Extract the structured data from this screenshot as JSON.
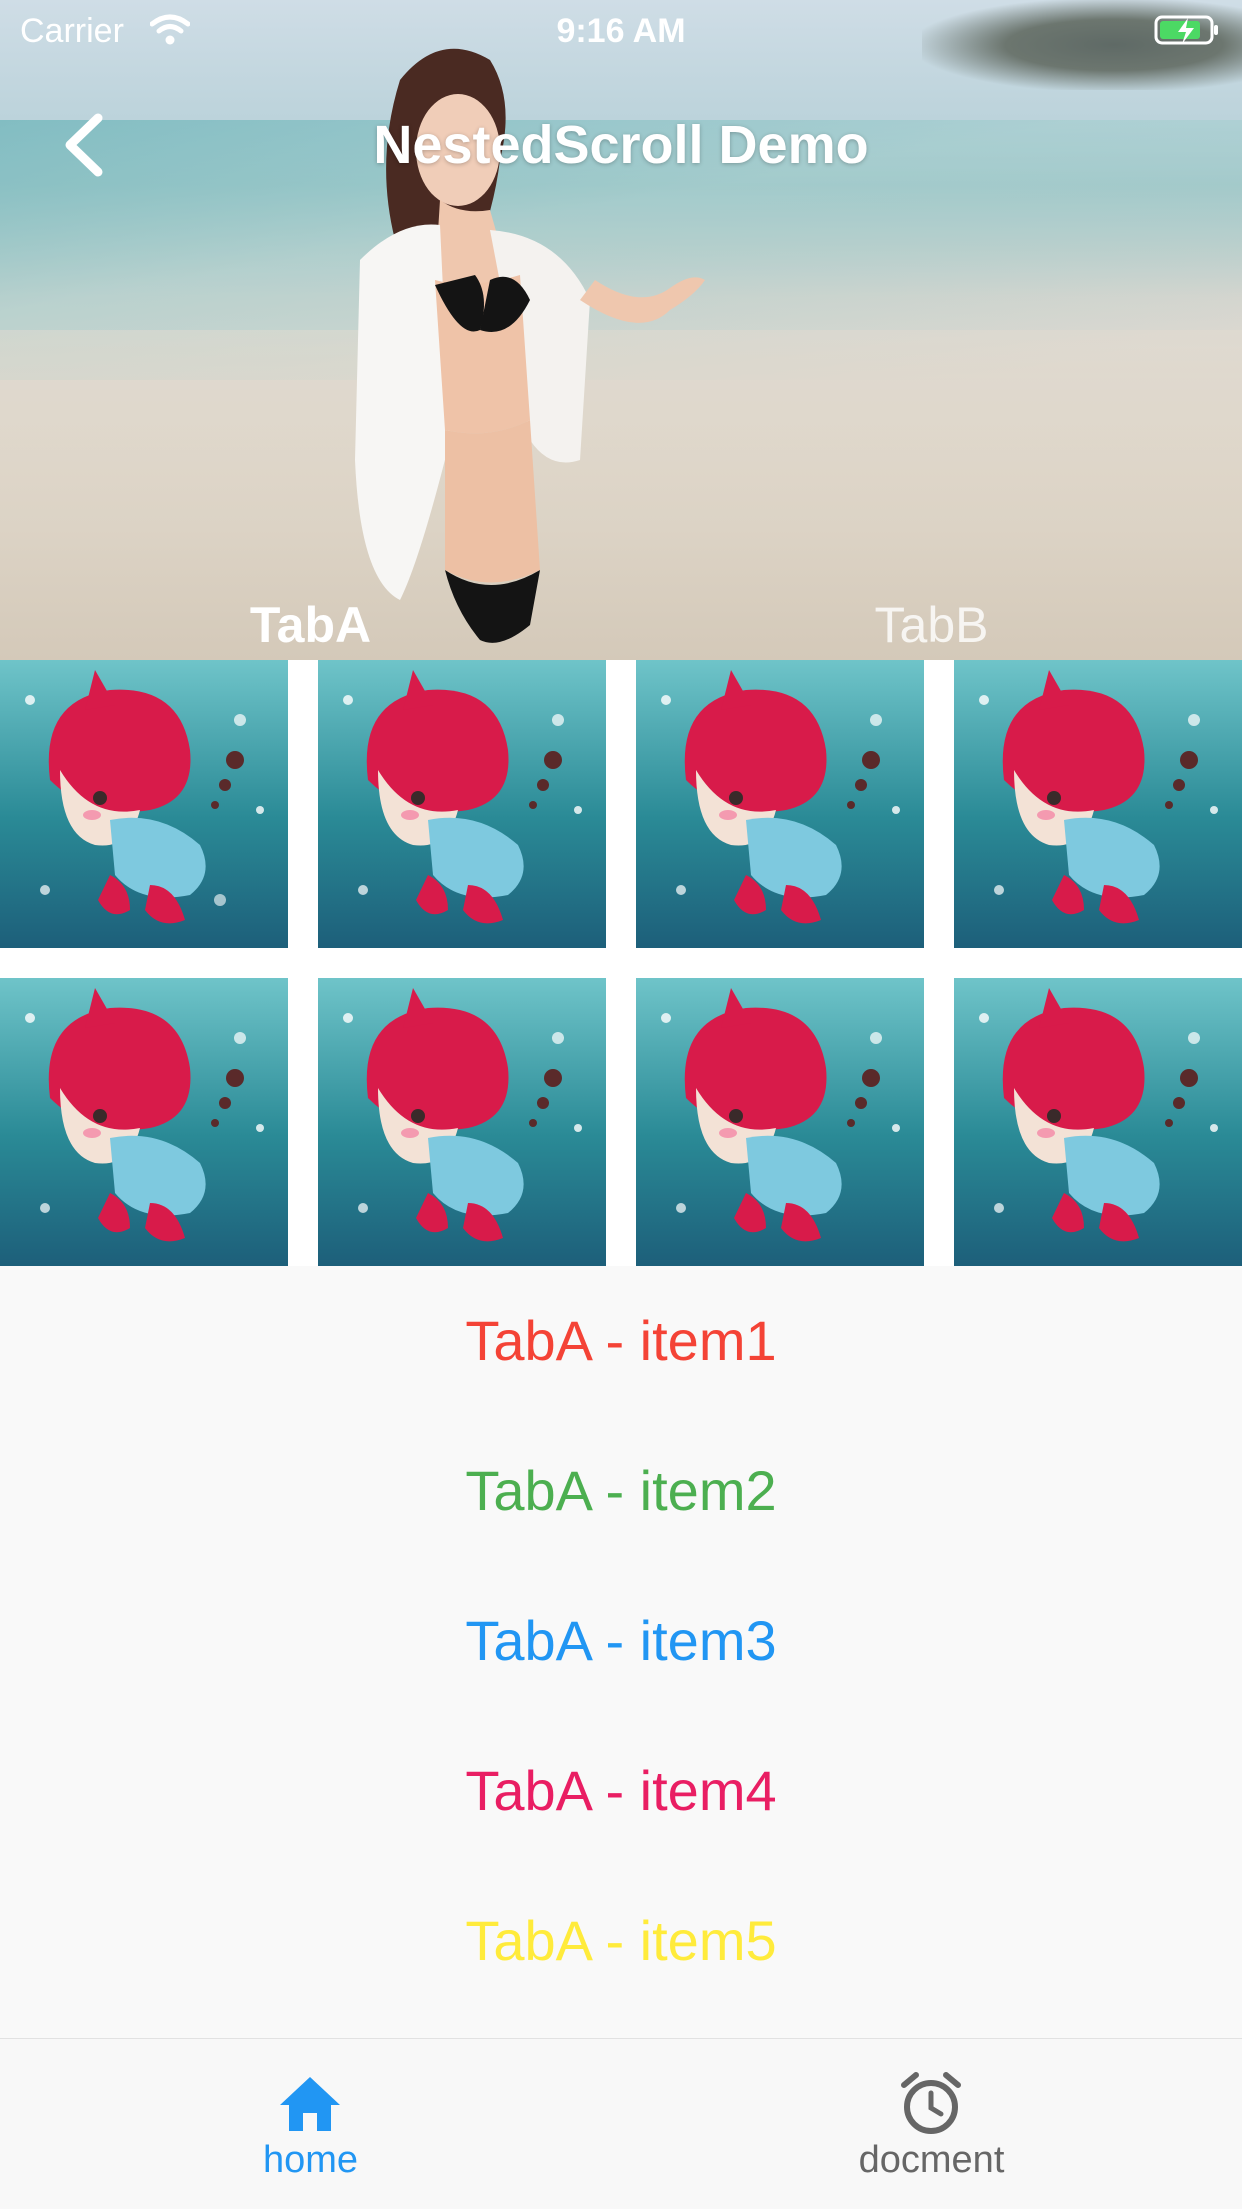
{
  "status_bar": {
    "carrier": "Carrier",
    "time": "9:16 AM",
    "icons": [
      "wifi-icon",
      "battery-charging-icon"
    ]
  },
  "nav": {
    "title": "NestedScroll Demo",
    "back_icon": "chevron-left-icon"
  },
  "tabs": [
    {
      "label": "TabA",
      "selected": true
    },
    {
      "label": "TabB",
      "selected": false
    }
  ],
  "grid": {
    "rows": 2,
    "columns": 4,
    "tile_image": "cartoon-character-image"
  },
  "list": {
    "items": [
      {
        "label": "TabA - item1",
        "color": "#f44336"
      },
      {
        "label": "TabA - item2",
        "color": "#4caf50"
      },
      {
        "label": "TabA - item3",
        "color": "#2196f3"
      },
      {
        "label": "TabA - item4",
        "color": "#e91e63"
      },
      {
        "label": "TabA - item5",
        "color": "#ffeb3b"
      }
    ]
  },
  "tabbar": {
    "items": [
      {
        "label": "home",
        "icon": "home-icon",
        "active": true,
        "color": "#2196f3"
      },
      {
        "label": "docment",
        "icon": "alarm-clock-icon",
        "active": false,
        "color": "#666666"
      }
    ]
  },
  "colors": {
    "accent": "#2196f3",
    "background": "#f9f9f9"
  }
}
